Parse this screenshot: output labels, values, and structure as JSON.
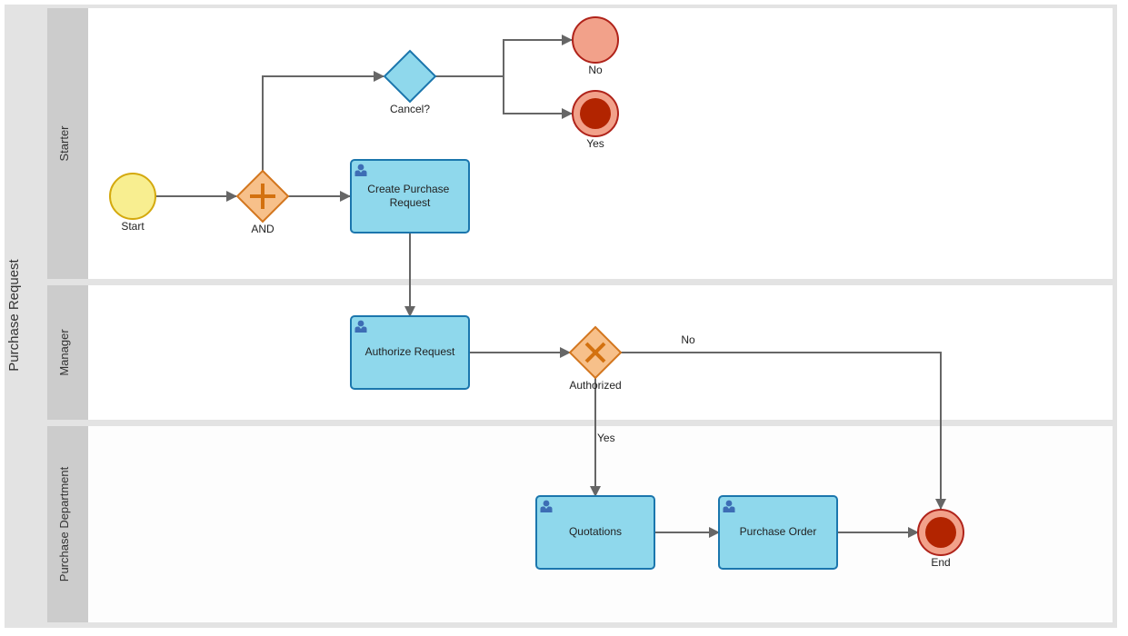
{
  "pool": {
    "title": "Purchase Request"
  },
  "lanes": [
    {
      "id": "starter",
      "title": "Starter"
    },
    {
      "id": "manager",
      "title": "Manager"
    },
    {
      "id": "purchase-dept",
      "title": "Purchase Department"
    }
  ],
  "colors": {
    "pool_header": "#e3e3e3",
    "lane_header": "#cccccc",
    "lane_body": "#ffffff",
    "task_fill": "#8fd8ec",
    "task_stroke": "#1b76ad",
    "task_icon": "#3d6db5",
    "start_fill": "#f8ee90",
    "start_stroke": "#d4a90e",
    "gateway_fill": "#f7c08a",
    "gateway_stroke": "#d3761e",
    "gateway_mark": "#d3710f",
    "decision_fill": "#8fd8ec",
    "decision_stroke": "#1b76ad",
    "end_fill": "#f2a18a",
    "end_stroke": "#b0231a",
    "end_inner": "#b22400",
    "flow": "#666666"
  },
  "nodes": {
    "start": {
      "label": "Start",
      "type": "start-event"
    },
    "and_gateway": {
      "label": "AND",
      "type": "parallel-gateway"
    },
    "cancel_gateway": {
      "label": "Cancel?",
      "type": "exclusive-gateway"
    },
    "end_no": {
      "label": "No",
      "type": "end-event"
    },
    "end_yes": {
      "label": "Yes",
      "type": "terminate-end-event"
    },
    "create_request": {
      "label_lines": [
        "Create Purchase",
        "Request"
      ],
      "type": "user-task"
    },
    "authorize_request": {
      "label": "Authorize Request",
      "type": "user-task"
    },
    "authorized_gateway": {
      "label": "Authorized",
      "type": "exclusive-gateway"
    },
    "quotations": {
      "label": "Quotations",
      "type": "user-task"
    },
    "purchase_order": {
      "label": "Purchase Order",
      "type": "user-task"
    },
    "end": {
      "label": "End",
      "type": "terminate-end-event"
    }
  },
  "flows": {
    "authorized_no": {
      "label": "No"
    },
    "authorized_yes": {
      "label": "Yes"
    }
  }
}
